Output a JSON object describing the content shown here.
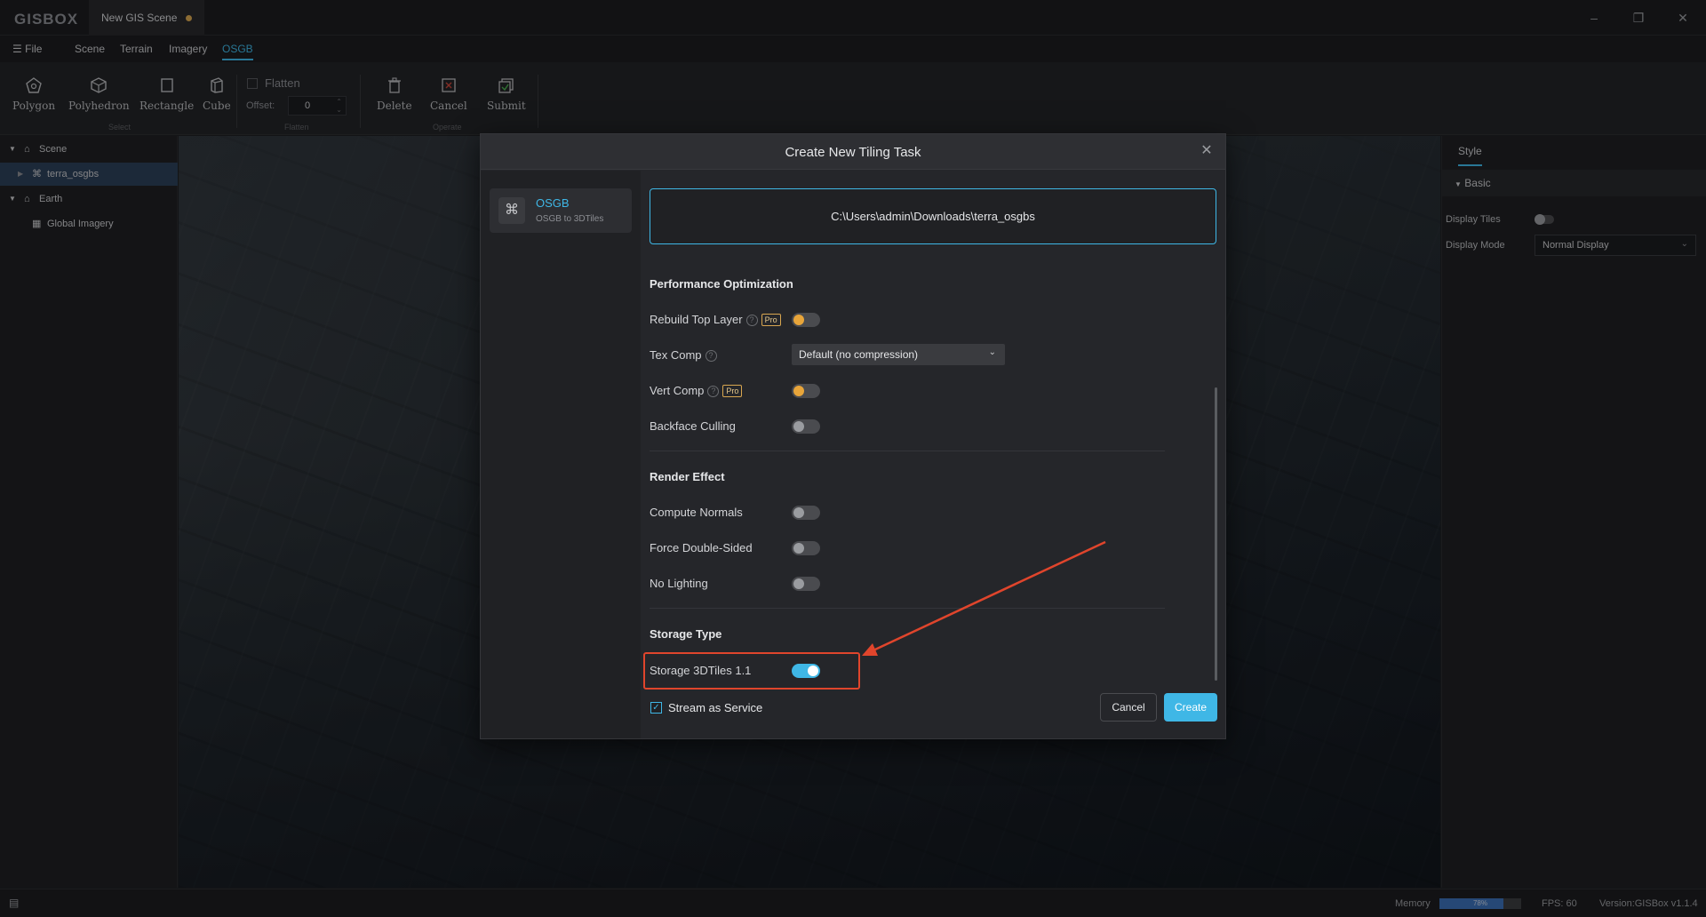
{
  "titlebar": {
    "logo": "GISBOX",
    "doc_tab": "New GIS Scene"
  },
  "menubar": {
    "file": "File",
    "items": [
      "Scene",
      "Terrain",
      "Imagery",
      "OSGB"
    ],
    "active": "OSGB"
  },
  "ribbon": {
    "select_tools": [
      "Polygon",
      "Polyhedron",
      "Rectangle",
      "Cube"
    ],
    "select_group": "Select",
    "flatten_label": "Flatten",
    "offset_label": "Offset:",
    "offset_value": "0",
    "flatten_group": "Flatten",
    "operate_tools": [
      "Delete",
      "Cancel",
      "Submit"
    ],
    "operate_group": "Operate"
  },
  "tree": {
    "items": [
      {
        "label": "Scene",
        "icon": "scene-icon"
      },
      {
        "label": "terra_osgbs",
        "icon": "osgb-icon"
      },
      {
        "label": "Earth",
        "icon": "earth-icon"
      },
      {
        "label": "Global Imagery",
        "icon": "imagery-icon"
      }
    ]
  },
  "right_panel": {
    "tab": "Style",
    "section": "Basic",
    "display_tiles_label": "Display Tiles",
    "display_mode_label": "Display Mode",
    "display_mode_value": "Normal Display"
  },
  "dialog": {
    "title": "Create New Tiling Task",
    "side_title": "OSGB",
    "side_subtitle": "OSGB to 3DTiles",
    "path": "C:\\Users\\admin\\Downloads\\terra_osgbs",
    "perf_section": "Performance Optimization",
    "rebuild_top_layer": "Rebuild Top Layer",
    "pro_badge": "Pro",
    "tex_comp": "Tex Comp",
    "tex_comp_value": "Default (no compression)",
    "vert_comp": "Vert Comp",
    "backface_culling": "Backface Culling",
    "render_section": "Render Effect",
    "compute_normals": "Compute Normals",
    "force_double_sided": "Force Double-Sided",
    "no_lighting": "No Lighting",
    "storage_section": "Storage Type",
    "storage_3dtiles": "Storage 3DTiles 1.1",
    "storage_3dtiles_on": true,
    "stream_as_service": "Stream as Service",
    "stream_checked": true,
    "cancel": "Cancel",
    "create": "Create"
  },
  "status": {
    "memory_label": "Memory",
    "memory_value": "78%",
    "memory_fraction": 0.78,
    "fps": "FPS: 60",
    "version": "Version:GISBox v1.1.4"
  },
  "colors": {
    "accent": "#3fb7e6",
    "annotation": "#e0452c",
    "pro": "#d8a650"
  }
}
